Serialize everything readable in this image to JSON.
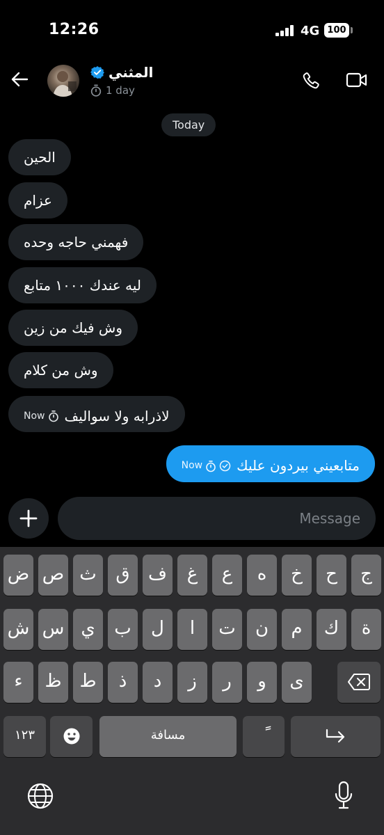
{
  "status_bar": {
    "time": "12:26",
    "network": "4G",
    "battery": "100"
  },
  "header": {
    "name": "المثني",
    "subtitle": "1 day"
  },
  "chat": {
    "date_label": "Today",
    "incoming": [
      {
        "text": "الحين"
      },
      {
        "text": "عزام"
      },
      {
        "text": "فهمني حاجه وحده"
      },
      {
        "text": "ليه عندك ١٠٠٠ متابع"
      },
      {
        "text": "وش فيك من زين"
      },
      {
        "text": "وش من كلام"
      },
      {
        "text": "لاذرابه ولا سواليف",
        "time": "Now"
      }
    ],
    "outgoing": [
      {
        "text": "متابعيني بيردون عليك",
        "time": "Now"
      }
    ]
  },
  "composer": {
    "placeholder": "Message"
  },
  "keyboard": {
    "row1": [
      "ض",
      "ص",
      "ث",
      "ق",
      "ف",
      "غ",
      "ع",
      "ه",
      "خ",
      "ح",
      "ج"
    ],
    "row2": [
      "ش",
      "س",
      "ي",
      "ب",
      "ل",
      "ا",
      "ت",
      "ن",
      "م",
      "ك",
      "ة"
    ],
    "row3": [
      "ء",
      "ظ",
      "ط",
      "ذ",
      "د",
      "ز",
      "ر",
      "و",
      "ى"
    ],
    "numbers_key": "١٢٣",
    "space_key": "مسافة",
    "diacritic_key": "ً"
  },
  "colors": {
    "accent": "#1d9bf0",
    "bubble": "#1e2226",
    "keyboard_bg": "#2c2c2e",
    "key": "#6b6b6d",
    "key_dark": "#474749"
  }
}
